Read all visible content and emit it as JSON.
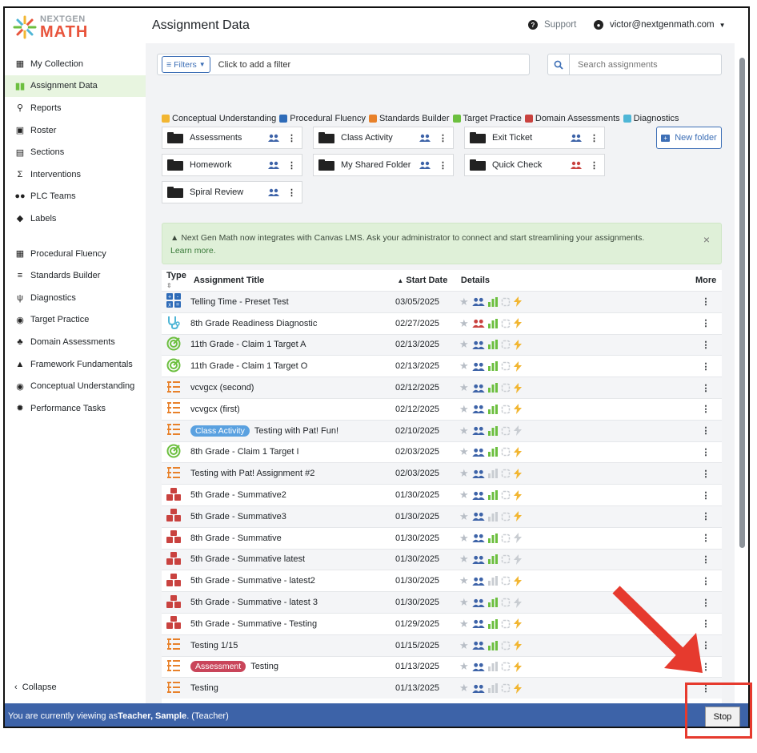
{
  "logo": {
    "line1": "NEXTGEN",
    "line2": "MATH"
  },
  "sidebar": {
    "items": [
      {
        "label": "My Collection",
        "icon": "books-icon",
        "active": false
      },
      {
        "label": "Assignment Data",
        "icon": "bar-chart-icon",
        "active": true
      },
      {
        "label": "Reports",
        "icon": "search-chart-icon",
        "active": false
      },
      {
        "label": "Roster",
        "icon": "roster-icon",
        "active": false
      },
      {
        "label": "Sections",
        "icon": "sections-icon",
        "active": false
      },
      {
        "label": "Interventions",
        "icon": "interventions-icon",
        "active": false
      },
      {
        "label": "PLC Teams",
        "icon": "team-icon",
        "active": false
      },
      {
        "label": "Labels",
        "icon": "tag-icon",
        "active": false
      }
    ],
    "items2": [
      {
        "label": "Procedural Fluency",
        "icon": "grid-icon"
      },
      {
        "label": "Standards Builder",
        "icon": "list-icon"
      },
      {
        "label": "Diagnostics",
        "icon": "stethoscope-icon"
      },
      {
        "label": "Target Practice",
        "icon": "target-icon"
      },
      {
        "label": "Domain Assessments",
        "icon": "blocks-icon"
      },
      {
        "label": "Framework Fundamentals",
        "icon": "pyramid-icon"
      },
      {
        "label": "Conceptual Understanding",
        "icon": "brain-icon"
      },
      {
        "label": "Performance Tasks",
        "icon": "cog-icon"
      }
    ],
    "collapse_label": "Collapse"
  },
  "header": {
    "title": "Assignment Data",
    "support_label": "Support",
    "user_email": "victor@nextgenmath.com"
  },
  "filters": {
    "button_label": "Filters",
    "placeholder": "Click to add a filter"
  },
  "search": {
    "placeholder": "Search assignments"
  },
  "legend": [
    {
      "label": "Conceptual Understanding",
      "color": "#f2b632"
    },
    {
      "label": "Procedural Fluency",
      "color": "#2e6bb8"
    },
    {
      "label": "Standards Builder",
      "color": "#e8812a"
    },
    {
      "label": "Target Practice",
      "color": "#6cbf3f"
    },
    {
      "label": "Domain Assessments",
      "color": "#c9423f"
    },
    {
      "label": "Diagnostics",
      "color": "#4fb6d6"
    }
  ],
  "folders": [
    {
      "label": "Assessments",
      "share_color": "#3d63a8"
    },
    {
      "label": "Class Activity",
      "share_color": "#3d63a8"
    },
    {
      "label": "Exit Ticket",
      "share_color": "#3d63a8"
    },
    {
      "label": "Homework",
      "share_color": "#3d63a8"
    },
    {
      "label": "My Shared Folder",
      "share_color": "#3d63a8"
    },
    {
      "label": "Quick Check",
      "share_color": "#c9423f"
    },
    {
      "label": "Spiral Review",
      "share_color": "#3d63a8"
    }
  ],
  "new_folder_label": "New folder",
  "banner": {
    "text": "Next Gen Math now integrates with Canvas LMS. Ask your administrator to connect and start streamlining your assignments.",
    "link": "Learn more.",
    "close": "×"
  },
  "table": {
    "headers": {
      "type": "Type",
      "title": "Assignment Title",
      "start_date": "Start Date",
      "details": "Details",
      "more": "More"
    },
    "rows": [
      {
        "type": "procedural",
        "badge": "",
        "title": "Telling Time - Preset Test",
        "date": "03/05/2025",
        "share_color": "#3d63a8",
        "bars": true,
        "bolt": true
      },
      {
        "type": "diagnostic",
        "badge": "",
        "title": "8th Grade Readiness Diagnostic",
        "date": "02/27/2025",
        "share_color": "#c9423f",
        "bars": true,
        "bolt": true
      },
      {
        "type": "target",
        "badge": "",
        "title": "11th Grade - Claim 1 Target A",
        "date": "02/13/2025",
        "share_color": "#3d63a8",
        "bars": true,
        "bolt": true
      },
      {
        "type": "target",
        "badge": "",
        "title": "11th Grade - Claim 1 Target O",
        "date": "02/13/2025",
        "share_color": "#3d63a8",
        "bars": true,
        "bolt": true
      },
      {
        "type": "standards",
        "badge": "",
        "title": "vcvgcx (second)",
        "date": "02/12/2025",
        "share_color": "#3d63a8",
        "bars": true,
        "bolt": true
      },
      {
        "type": "standards",
        "badge": "",
        "title": "vcvgcx (first)",
        "date": "02/12/2025",
        "share_color": "#3d63a8",
        "bars": true,
        "bolt": true
      },
      {
        "type": "standards",
        "badge": "Class Activity",
        "badge_color": "blue",
        "title": "Testing with Pat! Fun!",
        "date": "02/10/2025",
        "share_color": "#3d63a8",
        "bars": true,
        "bolt": false
      },
      {
        "type": "target",
        "badge": "",
        "title": "8th Grade - Claim 1 Target I",
        "date": "02/03/2025",
        "share_color": "#3d63a8",
        "bars": true,
        "bolt": true
      },
      {
        "type": "standards",
        "badge": "",
        "title": "Testing with Pat! Assignment #2",
        "date": "02/03/2025",
        "share_color": "#3d63a8",
        "bars": false,
        "bolt": true
      },
      {
        "type": "domain",
        "badge": "",
        "title": "5th Grade - Summative2",
        "date": "01/30/2025",
        "share_color": "#3d63a8",
        "bars": true,
        "bolt": true
      },
      {
        "type": "domain",
        "badge": "",
        "title": "5th Grade - Summative3",
        "date": "01/30/2025",
        "share_color": "#3d63a8",
        "bars": false,
        "bolt": true
      },
      {
        "type": "domain",
        "badge": "",
        "title": "8th Grade - Summative",
        "date": "01/30/2025",
        "share_color": "#3d63a8",
        "bars": true,
        "bolt": false
      },
      {
        "type": "domain",
        "badge": "",
        "title": "5th Grade - Summative latest",
        "date": "01/30/2025",
        "share_color": "#3d63a8",
        "bars": true,
        "bolt": false
      },
      {
        "type": "domain",
        "badge": "",
        "title": "5th Grade - Summative - latest2",
        "date": "01/30/2025",
        "share_color": "#3d63a8",
        "bars": false,
        "bolt": true
      },
      {
        "type": "domain",
        "badge": "",
        "title": "5th Grade - Summative - latest 3",
        "date": "01/30/2025",
        "share_color": "#3d63a8",
        "bars": true,
        "bolt": false
      },
      {
        "type": "domain",
        "badge": "",
        "title": "5th Grade - Summative - Testing",
        "date": "01/29/2025",
        "share_color": "#3d63a8",
        "bars": true,
        "bolt": true
      },
      {
        "type": "standards",
        "badge": "",
        "title": "Testing 1/15",
        "date": "01/15/2025",
        "share_color": "#3d63a8",
        "bars": true,
        "bolt": true
      },
      {
        "type": "standards",
        "badge": "Assessment",
        "badge_color": "red",
        "title": "Testing",
        "date": "01/13/2025",
        "share_color": "#3d63a8",
        "bars": false,
        "bolt": true
      },
      {
        "type": "standards",
        "badge": "",
        "title": "Testing",
        "date": "01/13/2025",
        "share_color": "#3d63a8",
        "bars": false,
        "bolt": true
      }
    ]
  },
  "statusbar": {
    "prefix": "You are currently viewing as ",
    "name": "Teacher, Sample",
    "suffix": ". (Teacher)",
    "stop_label": "Stop"
  },
  "colors": {
    "accent": "#3d63a8",
    "annotation": "#e63a2e"
  }
}
